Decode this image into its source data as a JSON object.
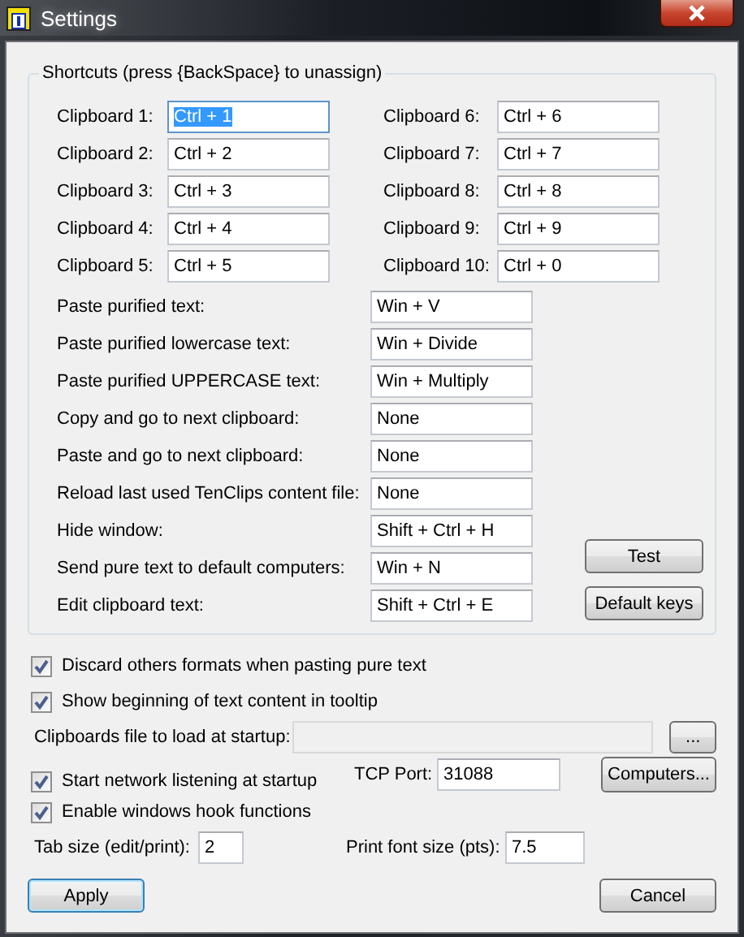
{
  "window": {
    "title": "Settings"
  },
  "shortcuts": {
    "title": "Shortcuts (press {BackSpace} to unassign)",
    "clipboards": [
      {
        "label": "Clipboard 1:",
        "value": "Ctrl + 1",
        "focused": true
      },
      {
        "label": "Clipboard 2:",
        "value": "Ctrl + 2",
        "focused": false
      },
      {
        "label": "Clipboard 3:",
        "value": "Ctrl + 3",
        "focused": false
      },
      {
        "label": "Clipboard 4:",
        "value": "Ctrl + 4",
        "focused": false
      },
      {
        "label": "Clipboard 5:",
        "value": "Ctrl + 5",
        "focused": false
      },
      {
        "label": "Clipboard 6:",
        "value": "Ctrl + 6",
        "focused": false
      },
      {
        "label": "Clipboard 7:",
        "value": "Ctrl + 7",
        "focused": false
      },
      {
        "label": "Clipboard 8:",
        "value": "Ctrl + 8",
        "focused": false
      },
      {
        "label": "Clipboard 9:",
        "value": "Ctrl + 9",
        "focused": false
      },
      {
        "label": "Clipboard 10:",
        "value": "Ctrl + 0",
        "focused": false
      }
    ],
    "actions": [
      {
        "label": "Paste purified text:",
        "value": "Win + V"
      },
      {
        "label": "Paste purified lowercase text:",
        "value": "Win + Divide"
      },
      {
        "label": "Paste purified UPPERCASE text:",
        "value": "Win + Multiply"
      },
      {
        "label": "Copy and go to next clipboard:",
        "value": "None"
      },
      {
        "label": "Paste and go to next clipboard:",
        "value": "None"
      },
      {
        "label": "Reload last used TenClips content file:",
        "value": "None"
      },
      {
        "label": "Hide window:",
        "value": "Shift + Ctrl + H"
      },
      {
        "label": "Send pure text to default computers:",
        "value": "Win + N"
      },
      {
        "label": "Edit clipboard text:",
        "value": "Shift + Ctrl + E"
      }
    ],
    "buttons": [
      "Test",
      "Default keys"
    ]
  },
  "discard_formats": {
    "label": "Discard others formats when pasting pure text",
    "checked": true
  },
  "show_tooltip": {
    "label": "Show beginning of text content in tooltip",
    "checked": true
  },
  "startup_file": {
    "label": "Clipboards file to load at startup:",
    "browse": "..."
  },
  "network": {
    "label": "Start network listening at startup",
    "checked": true,
    "port_label": "TCP Port:",
    "port": "31088",
    "button": "Computers..."
  },
  "hook": {
    "label": "Enable windows hook functions",
    "checked": true
  },
  "tab_size": {
    "label": "Tab size (edit/print):",
    "value": "2"
  },
  "print_font": {
    "label": "Print font size (pts):",
    "value": "7.5"
  },
  "footer": {
    "apply": "Apply",
    "cancel": "Cancel"
  }
}
